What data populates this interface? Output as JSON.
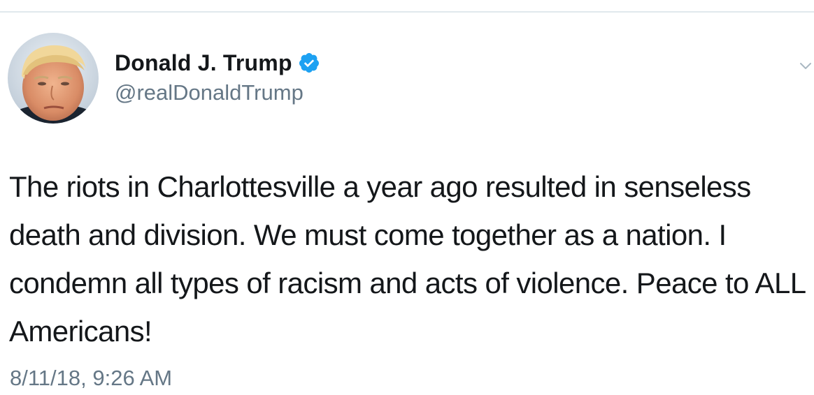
{
  "tweet": {
    "author": {
      "display_name": "Donald J. Trump",
      "handle": "@realDonaldTrump",
      "verified": true,
      "avatar_icon": "profile-photo"
    },
    "text": "The riots in Charlottesville a year ago resulted in senseless death and division. We must come together as a nation. I condemn all types of racism and acts of violence. Peace to ALL Americans!",
    "timestamp": "8/11/18, 9:26 AM",
    "menu_icon": "chevron-down-icon"
  },
  "colors": {
    "primary_text": "#14171a",
    "secondary_text": "#657786",
    "verified_badge": "#1da1f2",
    "divider": "#e1e8ed"
  }
}
